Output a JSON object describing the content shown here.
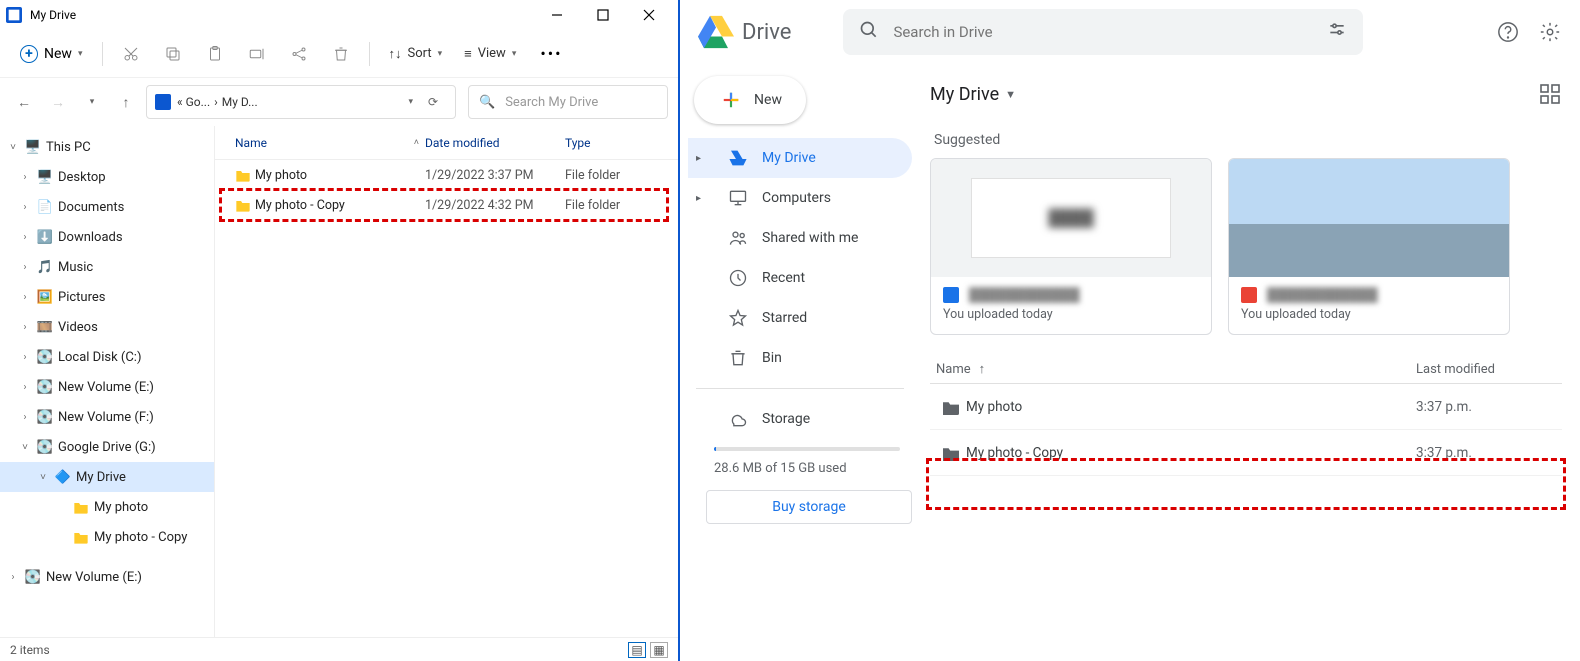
{
  "explorer": {
    "title": "My Drive",
    "toolbar": {
      "new_label": "New",
      "sort_label": "Sort",
      "view_label": "View"
    },
    "breadcrumb": {
      "part1": "« Go...",
      "part2": "My D..."
    },
    "search_placeholder": "Search My Drive",
    "columns": {
      "name": "Name",
      "date": "Date modified",
      "type": "Type"
    },
    "rows": [
      {
        "name": "My photo",
        "date": "1/29/2022 3:37 PM",
        "type": "File folder"
      },
      {
        "name": "My photo - Copy",
        "date": "1/29/2022 4:32 PM",
        "type": "File folder"
      }
    ],
    "status": "2 items",
    "tree": {
      "this_pc": "This PC",
      "desktop": "Desktop",
      "documents": "Documents",
      "downloads": "Downloads",
      "music": "Music",
      "pictures": "Pictures",
      "videos": "Videos",
      "local_c": "Local Disk (C:)",
      "vol_e": "New Volume (E:)",
      "vol_f": "New Volume (F:)",
      "gdrive": "Google Drive (G:)",
      "mydrive": "My Drive",
      "myphoto": "My photo",
      "myphoto_copy": "My photo - Copy",
      "vol_e2": "New Volume (E:)"
    }
  },
  "gdrive": {
    "logo_text": "Drive",
    "search_placeholder": "Search in Drive",
    "new_label": "New",
    "nav": {
      "mydrive": "My Drive",
      "computers": "Computers",
      "shared": "Shared with me",
      "recent": "Recent",
      "starred": "Starred",
      "bin": "Bin",
      "storage": "Storage"
    },
    "storage_text": "28.6 MB of 15 GB used",
    "buy_label": "Buy storage",
    "main_title": "My Drive",
    "suggested_label": "Suggested",
    "cards": [
      {
        "uploaded": "You uploaded today"
      },
      {
        "uploaded": "You uploaded today"
      }
    ],
    "table": {
      "head_name": "Name",
      "head_mod": "Last modified",
      "rows": [
        {
          "name": "My photo",
          "time": "3:37 p.m."
        },
        {
          "name": "My photo - Copy",
          "time": "3:37 p.m."
        }
      ]
    }
  }
}
